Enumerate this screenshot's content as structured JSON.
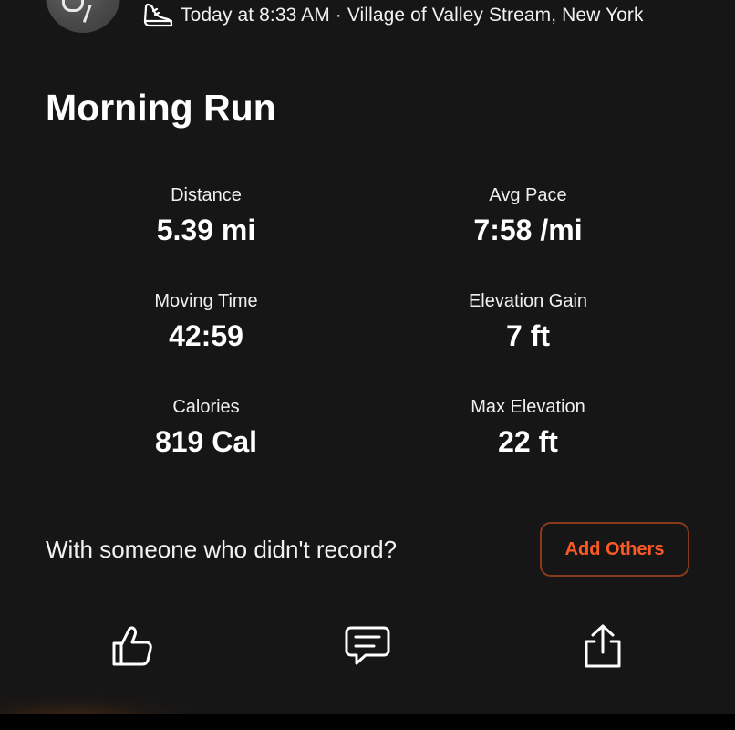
{
  "header": {
    "meta_text": "Today at 8:33 AM · Village of Valley Stream, New York",
    "activity_icon": "running-shoe-icon"
  },
  "activity": {
    "title": "Morning Run"
  },
  "stats": [
    {
      "label": "Distance",
      "value": "5.39 mi"
    },
    {
      "label": "Avg Pace",
      "value": "7:58 /mi"
    },
    {
      "label": "Moving Time",
      "value": "42:59"
    },
    {
      "label": "Elevation Gain",
      "value": "7 ft"
    },
    {
      "label": "Calories",
      "value": "819 Cal"
    },
    {
      "label": "Max Elevation",
      "value": "22 ft"
    }
  ],
  "prompt": {
    "text": "With someone who didn't record?",
    "button_label": "Add Others"
  },
  "actions": {
    "icons": [
      "thumbs-up-icon",
      "comment-icon",
      "share-icon"
    ]
  },
  "colors": {
    "background": "#161616",
    "accent": "#fc5a24",
    "button_border": "#8a3a1c"
  }
}
